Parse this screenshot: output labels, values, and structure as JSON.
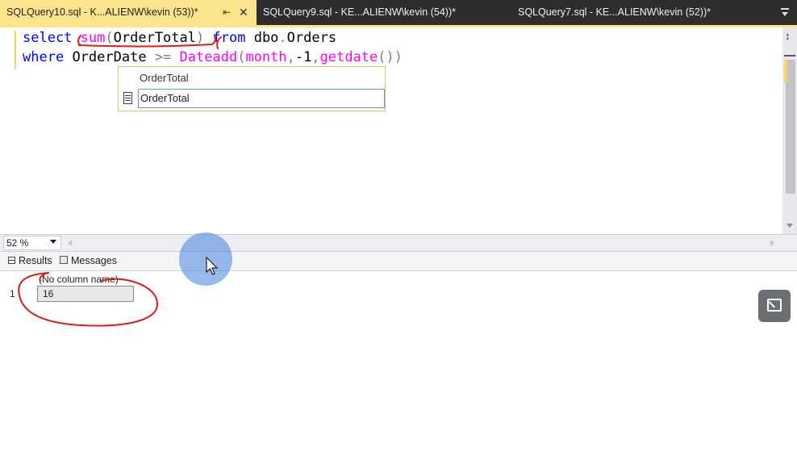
{
  "tabs": [
    {
      "label": "SQLQuery10.sql - K...ALIENW\\kevin (53))*",
      "active": true,
      "pin_icon": "pin-icon",
      "close_icon": "close-icon"
    },
    {
      "label": "SQLQuery9.sql - KE...ALIENW\\kevin (54))*",
      "active": false
    },
    {
      "label": "SQLQuery7.sql - KE...ALIENW\\kevin (52))*",
      "active": false
    }
  ],
  "editor": {
    "line1": {
      "kw1": "select",
      "fn1": "sum",
      "p1": "(",
      "id1": "OrderTotal",
      "p2": ")",
      "kw2": "from",
      "id2": "dbo",
      "dot": ".",
      "id3": "Orders"
    },
    "line2": {
      "kw1": "where",
      "id1": "OrderDate",
      "op": ">=",
      "fn1": "Dateadd",
      "p1": "(",
      "fn2": "month",
      "c1": ",",
      "num": "-1",
      "c2": ",",
      "fn3": "getdate",
      "p2": "())"
    }
  },
  "intellisense": {
    "header": "OrderTotal",
    "item": "OrderTotal",
    "item_icon": "column-icon"
  },
  "zoom": {
    "value": "52 %"
  },
  "results_tabs": {
    "results": "Results",
    "messages": "Messages"
  },
  "results": {
    "columns": [
      "(No column name)"
    ],
    "rows": [
      {
        "num": "1",
        "values": [
          "16"
        ]
      }
    ]
  },
  "colors": {
    "active_tab": "#fce48c",
    "tab_bar": "#2d2d30",
    "keyword": "#0000ff",
    "function": "#ff00ff",
    "operator": "#808080",
    "annotation_ink": "#e01b1b",
    "spotlight": "#4682dc"
  }
}
